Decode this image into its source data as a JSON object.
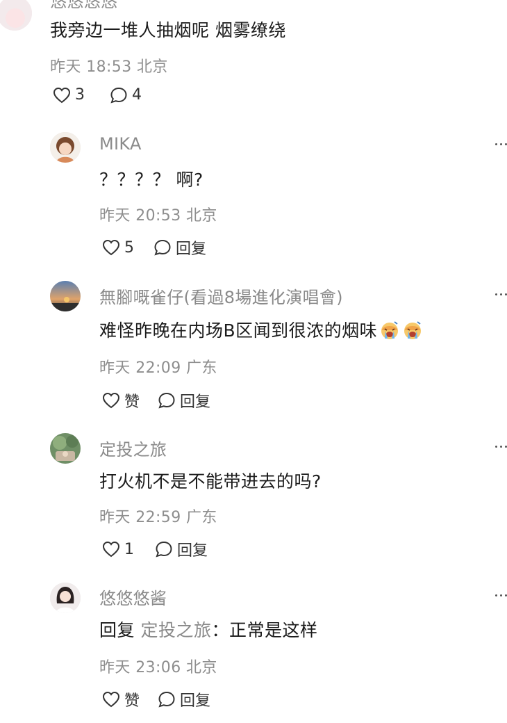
{
  "top_comment": {
    "username": "悠悠悠悠",
    "text": "我旁边一堆人抽烟呢 烟雾缭绕",
    "time": "昨天 18:53",
    "location": "北京",
    "likes": "3",
    "replies": "4"
  },
  "replies": [
    {
      "username": "MIKA",
      "text": "？？？？ 啊?",
      "time": "昨天 20:53",
      "location": "北京",
      "like_label": "5",
      "reply_label": "回复"
    },
    {
      "username": "無腳嘅雀仔(看過8場進化演唱會)",
      "text": "难怪昨晚在内场B区闻到很浓的烟味",
      "emojis": [
        "crying-face-emoji",
        "crying-face-emoji"
      ],
      "time": "昨天 22:09",
      "location": "广东",
      "like_label": "赞",
      "reply_label": "回复"
    },
    {
      "username": "定投之旅",
      "text": "打火机不是不能带进去的吗?",
      "time": "昨天 22:59",
      "location": "广东",
      "like_label": "1",
      "reply_label": "回复"
    },
    {
      "username": "悠悠悠酱",
      "reply_prefix": "回复",
      "reply_to": "定投之旅",
      "text": "：正常是这样",
      "time": "昨天 23:06",
      "location": "北京",
      "like_label": "赞",
      "reply_label": "回复"
    }
  ]
}
